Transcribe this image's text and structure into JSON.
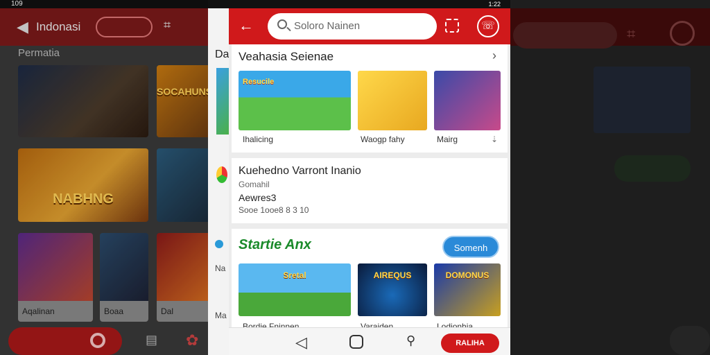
{
  "bg_left": {
    "status_time": "109",
    "title": "Indonasi",
    "section_title": "Permatia",
    "tile_captions": [
      "Aqalinan",
      "Boaa",
      "Dal"
    ],
    "tile_arts": [
      "SOCAHUNS",
      "NABHNG"
    ]
  },
  "mid": {
    "heading_frag": "Da",
    "line_frag": "Na",
    "line_frag2": "Ma"
  },
  "front": {
    "status_time": "1:22",
    "search_placeholder": "Soloro Nainen",
    "card1": {
      "title": "Veahasia Seienae",
      "games": [
        {
          "name": "Ihalicing",
          "art": "Resucile"
        },
        {
          "name": "Waogp fahy",
          "art": ""
        },
        {
          "name": "Mairg",
          "art": ""
        }
      ]
    },
    "card2": {
      "title": "Kuehedno Varront Inanio",
      "sub1": "Gomahil",
      "sub2": "Aewres3",
      "sub3": "Sooe 1ooe8 8 3 10"
    },
    "card3": {
      "title": "Startie Anx",
      "button": "Somenh",
      "games": [
        {
          "name": "Bordie Fninnen",
          "art": "Sretal"
        },
        {
          "name": "Varaiden",
          "art": "AIREQUS"
        },
        {
          "name": "Lodionhia",
          "art": "DOMONUS"
        }
      ]
    },
    "nav": {
      "promo": "RALIHA"
    }
  }
}
